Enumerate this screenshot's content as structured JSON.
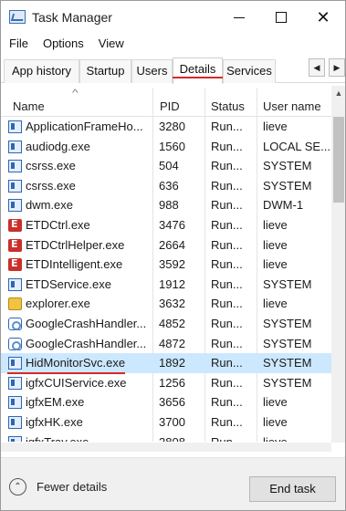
{
  "window": {
    "title": "Task Manager"
  },
  "menu": [
    "File",
    "Options",
    "View"
  ],
  "tabs": [
    "App history",
    "Startup",
    "Users",
    "Details",
    "Services"
  ],
  "active_tab": "Details",
  "columns": {
    "name": "Name",
    "pid": "PID",
    "status": "Status",
    "user": "User name"
  },
  "rows": [
    {
      "name": "ApplicationFrameHo...",
      "pid": "3280",
      "status": "Run...",
      "user": "lieve",
      "icon": "window-icon"
    },
    {
      "name": "audiodg.exe",
      "pid": "1560",
      "status": "Run...",
      "user": "LOCAL SE...",
      "icon": "window-icon"
    },
    {
      "name": "csrss.exe",
      "pid": "504",
      "status": "Run...",
      "user": "SYSTEM",
      "icon": "window-icon"
    },
    {
      "name": "csrss.exe",
      "pid": "636",
      "status": "Run...",
      "user": "SYSTEM",
      "icon": "window-icon"
    },
    {
      "name": "dwm.exe",
      "pid": "988",
      "status": "Run...",
      "user": "DWM-1",
      "icon": "window-icon"
    },
    {
      "name": "ETDCtrl.exe",
      "pid": "3476",
      "status": "Run...",
      "user": "lieve",
      "icon": "etd-icon"
    },
    {
      "name": "ETDCtrlHelper.exe",
      "pid": "2664",
      "status": "Run...",
      "user": "lieve",
      "icon": "etd-icon"
    },
    {
      "name": "ETDIntelligent.exe",
      "pid": "3592",
      "status": "Run...",
      "user": "lieve",
      "icon": "etd-icon"
    },
    {
      "name": "ETDService.exe",
      "pid": "1912",
      "status": "Run...",
      "user": "SYSTEM",
      "icon": "window-icon"
    },
    {
      "name": "explorer.exe",
      "pid": "3632",
      "status": "Run...",
      "user": "lieve",
      "icon": "explorer-icon"
    },
    {
      "name": "GoogleCrashHandler...",
      "pid": "4852",
      "status": "Run...",
      "user": "SYSTEM",
      "icon": "gear-icon"
    },
    {
      "name": "GoogleCrashHandler...",
      "pid": "4872",
      "status": "Run...",
      "user": "SYSTEM",
      "icon": "gear-icon"
    },
    {
      "name": "HidMonitorSvc.exe",
      "pid": "1892",
      "status": "Run...",
      "user": "SYSTEM",
      "icon": "window-icon",
      "selected": true
    },
    {
      "name": "igfxCUIService.exe",
      "pid": "1256",
      "status": "Run...",
      "user": "SYSTEM",
      "icon": "window-icon"
    },
    {
      "name": "igfxEM.exe",
      "pid": "3656",
      "status": "Run...",
      "user": "lieve",
      "icon": "window-icon"
    },
    {
      "name": "igfxHK.exe",
      "pid": "3700",
      "status": "Run...",
      "user": "lieve",
      "icon": "window-icon"
    },
    {
      "name": "igfxTray.exe",
      "pid": "3808",
      "status": "Run...",
      "user": "lieve",
      "icon": "window-icon"
    }
  ],
  "footer": {
    "fewer_details": "Fewer details",
    "end_task": "End task"
  },
  "colors": {
    "selection": "#cce8ff",
    "accent_underline": "#d42a2a"
  }
}
